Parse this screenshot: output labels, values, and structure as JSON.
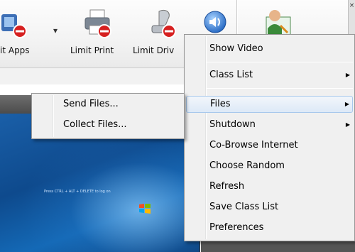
{
  "toolbar": {
    "items": [
      {
        "label": "it Apps",
        "icon": "limit-apps-icon"
      },
      {
        "label": "Limit Print",
        "icon": "printer-blocked-icon"
      },
      {
        "label": "Limit Driv",
        "icon": "drive-blocked-icon"
      },
      {
        "label": "",
        "icon": "speaker-icon"
      },
      {
        "label": "",
        "icon": "teacher-icon"
      }
    ],
    "dropdown_glyph": "▾",
    "close_glyph": "×"
  },
  "context_menu": {
    "items": [
      {
        "label": "Show Video",
        "has_submenu": false
      },
      {
        "label": "Class List",
        "has_submenu": true
      },
      {
        "label": "Files",
        "has_submenu": true,
        "highlighted": true
      },
      {
        "label": "Shutdown",
        "has_submenu": true
      },
      {
        "label": "Co-Browse Internet",
        "has_submenu": false
      },
      {
        "label": "Choose Random",
        "has_submenu": false
      },
      {
        "label": "Refresh",
        "has_submenu": false
      },
      {
        "label": "Save Class List",
        "has_submenu": false
      },
      {
        "label": "Preferences",
        "has_submenu": false
      }
    ],
    "submenu_arrow": "▶"
  },
  "files_submenu": {
    "items": [
      {
        "label": "Send Files..."
      },
      {
        "label": "Collect Files..."
      }
    ]
  },
  "desktop": {
    "caption": "Press CTRL + ALT + DELETE to log on"
  },
  "colors": {
    "menu_bg": "#f0f0f0",
    "menu_highlight": "#dde9f7",
    "menu_highlight_border": "#a8c8ec",
    "desktop_blue": "#1a5fa8"
  }
}
